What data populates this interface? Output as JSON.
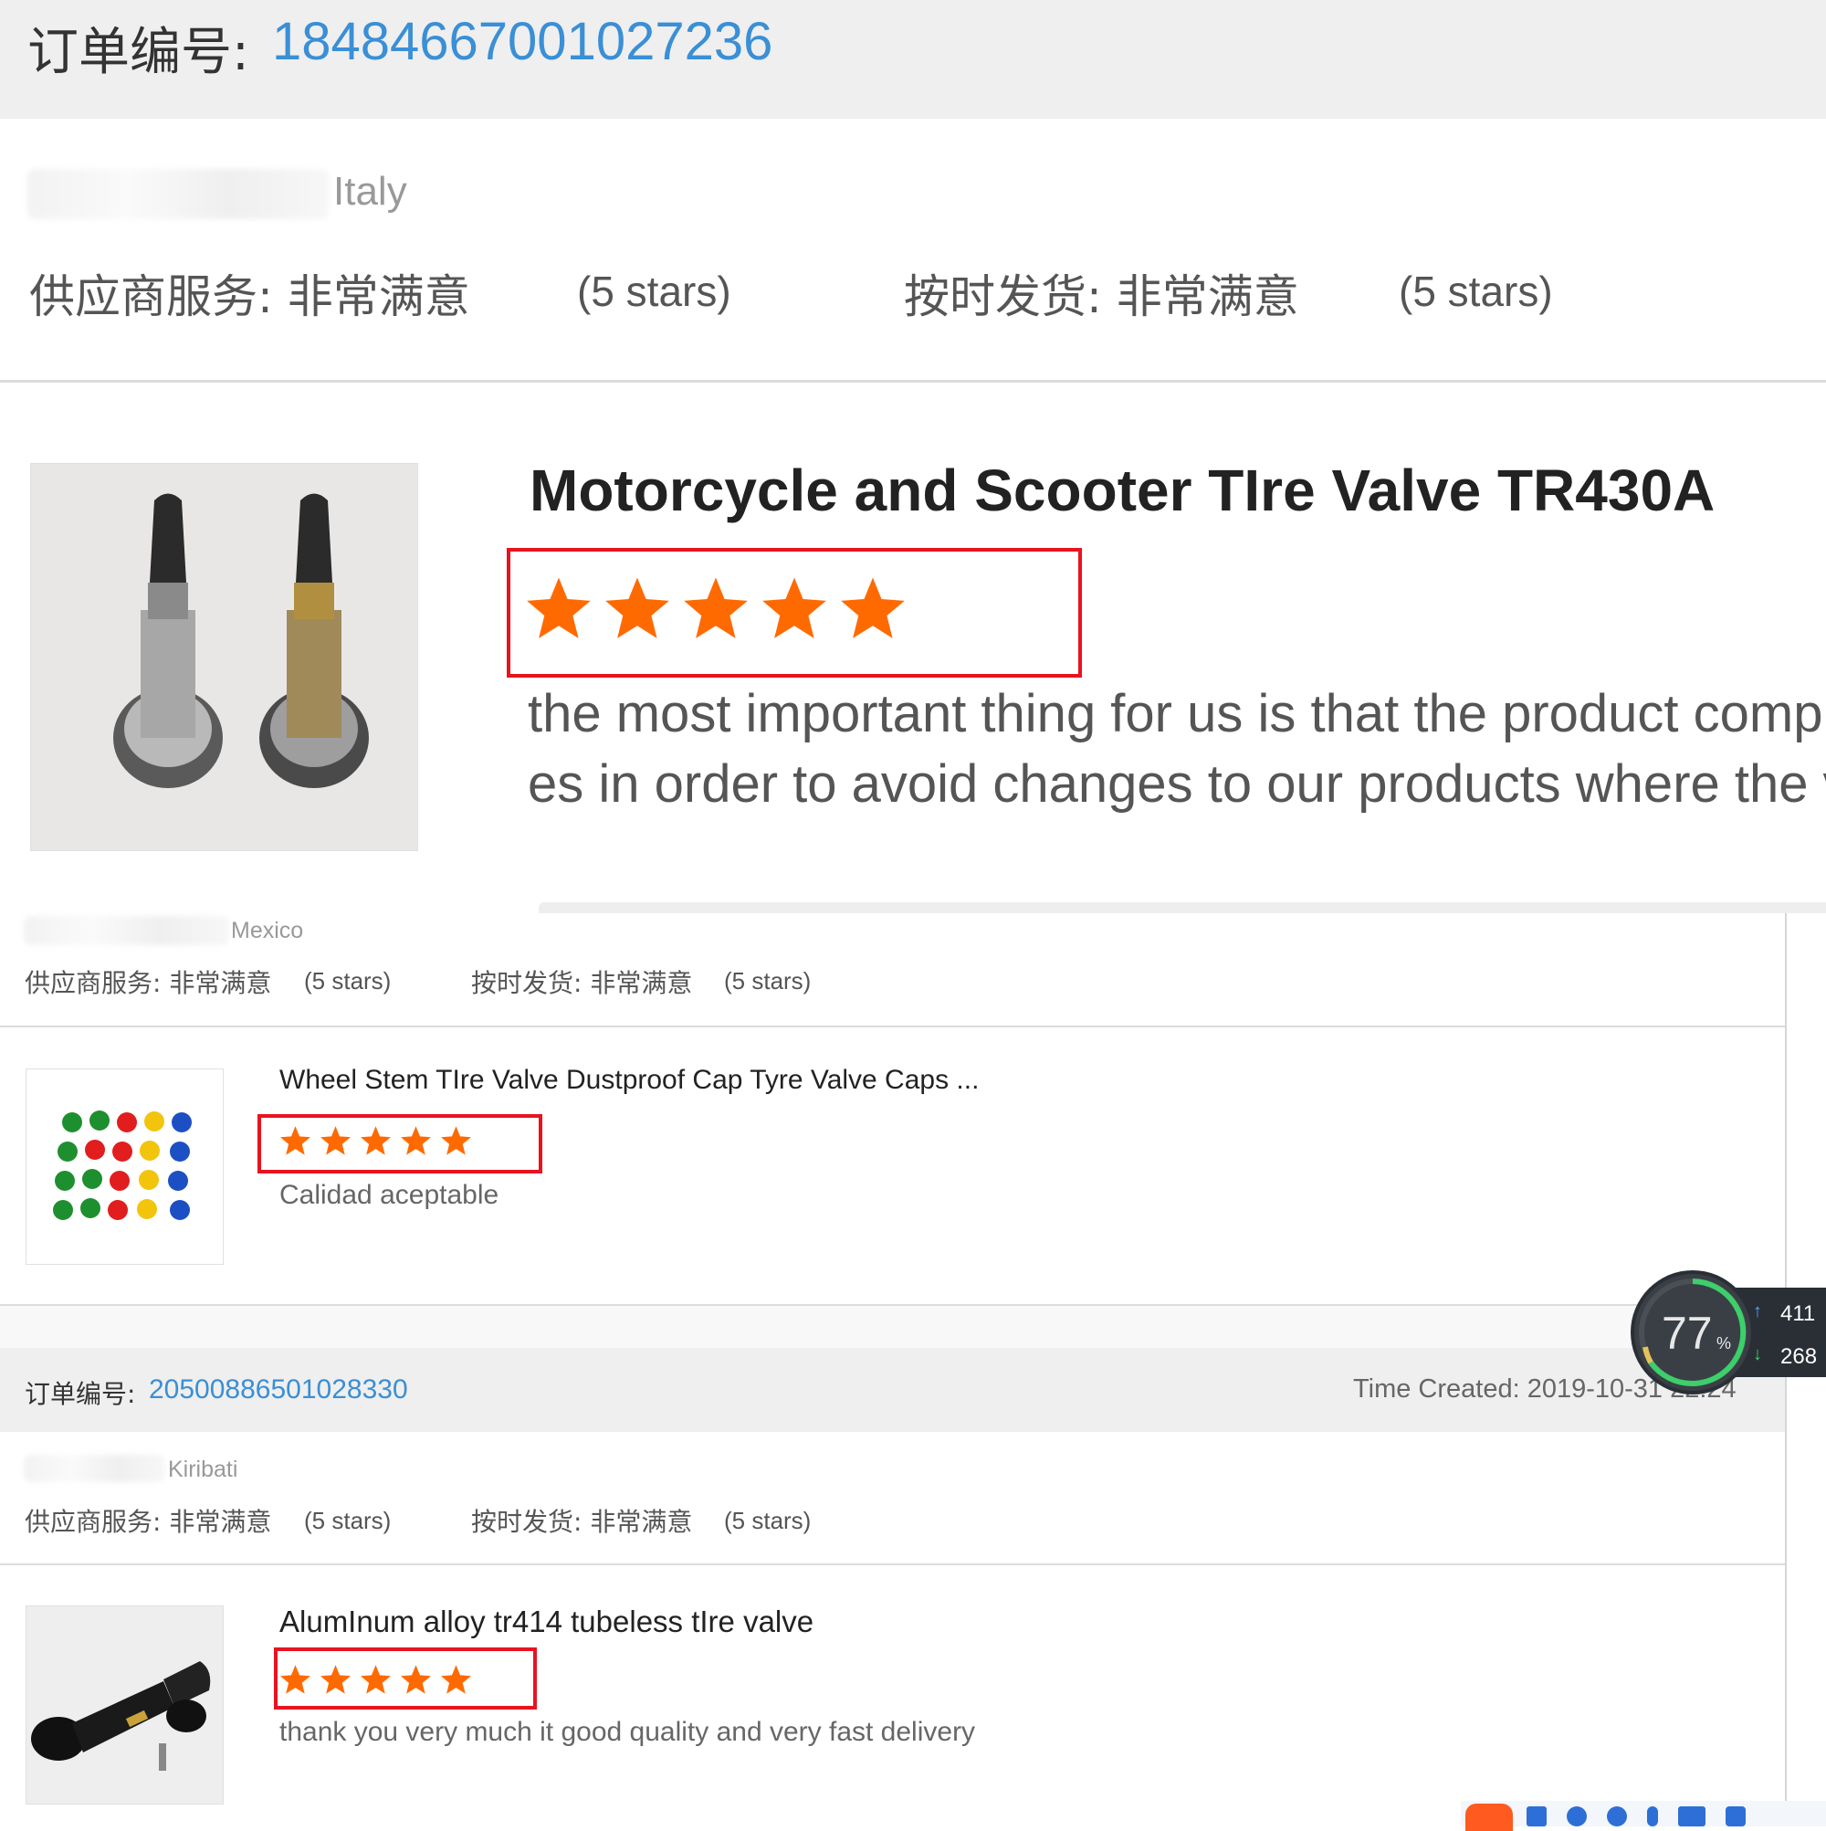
{
  "header": {
    "order_label": "订单编号:",
    "order_number": "18484667001027236"
  },
  "review1": {
    "country": "Italy",
    "supplier_service": "供应商服务: 非常满意",
    "supplier_stars": "(5 stars)",
    "ontime_shipping": "按时发货: 非常满意",
    "ontime_stars": "(5 stars)",
    "product_title": "Motorcycle and Scooter TIre Valve TR430A",
    "rating": 5,
    "comment_line1": "the most important thing for us is that the product comp",
    "comment_line2": "es in order to avoid changes to our products where the v"
  },
  "review2": {
    "country": "Mexico",
    "supplier_service": "供应商服务: 非常满意",
    "supplier_stars": "(5 stars)",
    "ontime_shipping": "按时发货: 非常满意",
    "ontime_stars": "(5 stars)",
    "product_title": "Wheel Stem TIre Valve Dustproof Cap Tyre Valve Caps ...",
    "rating": 5,
    "comment": "Calidad aceptable"
  },
  "order2": {
    "order_label": "订单编号:",
    "order_number": "20500886501028330",
    "time_created": "Time Created: 2019-10-31 22:24"
  },
  "review3": {
    "country": "Kiribati",
    "supplier_service": "供应商服务: 非常满意",
    "supplier_stars": "(5 stars)",
    "ontime_shipping": "按时发货: 非常满意",
    "ontime_stars": "(5 stars)",
    "product_title": "AlumInum alloy tr414 tubeless tIre valve",
    "rating": 5,
    "comment": "thank you very much it good quality and very fast delivery"
  },
  "widget": {
    "percent": "77",
    "percent_unit": "%",
    "upload": "411",
    "download": "268"
  },
  "colors": {
    "accent_blue": "#3a8fd6",
    "star_orange": "#ff6a00",
    "highlight_red": "#e8131f"
  }
}
